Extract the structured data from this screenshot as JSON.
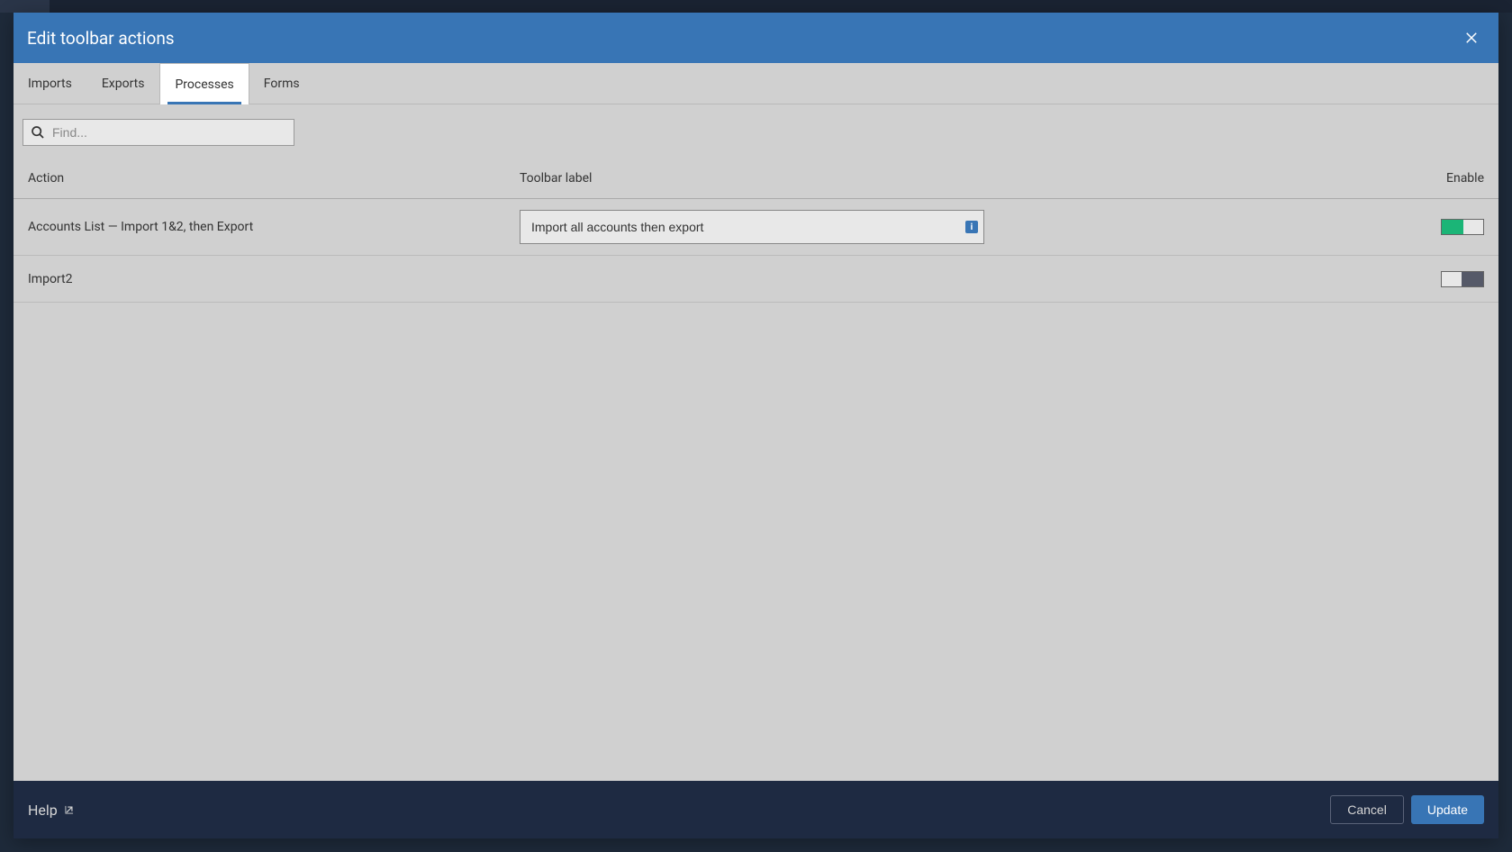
{
  "modal": {
    "title": "Edit toolbar actions"
  },
  "tabs": [
    {
      "label": "Imports",
      "active": false
    },
    {
      "label": "Exports",
      "active": false
    },
    {
      "label": "Processes",
      "active": true
    },
    {
      "label": "Forms",
      "active": false
    }
  ],
  "search": {
    "placeholder": "Find..."
  },
  "columns": {
    "action": "Action",
    "label": "Toolbar label",
    "enable": "Enable"
  },
  "rows": [
    {
      "action": "Accounts List — Import 1&2, then Export",
      "label_value": "Import all accounts then export",
      "enabled": true
    },
    {
      "action": "Import2",
      "label_value": "",
      "enabled": false
    }
  ],
  "footer": {
    "help": "Help",
    "cancel": "Cancel",
    "update": "Update"
  }
}
